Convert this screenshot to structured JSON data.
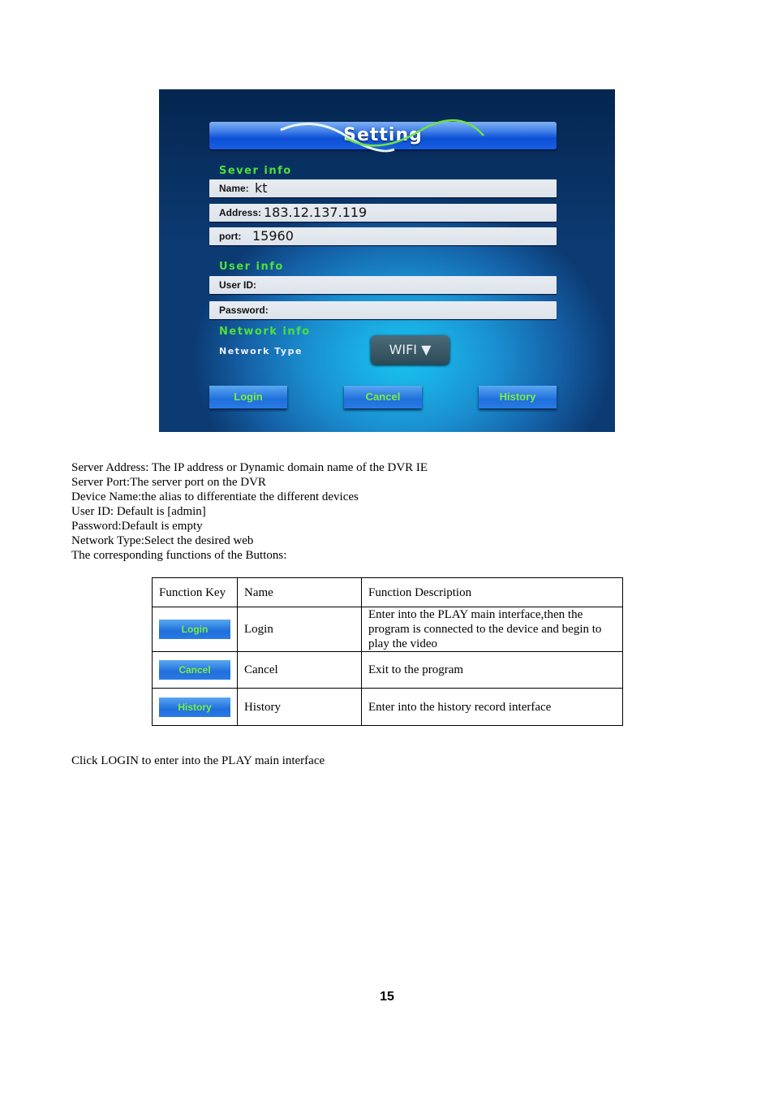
{
  "screenshot": {
    "title": "Setting",
    "server_section": "Sever info",
    "name_label": "Name:",
    "name_value": "kt",
    "address_label": "Address:",
    "address_value": "183.12.137.119",
    "port_label": "port:",
    "port_value": "15960",
    "user_section": "User info",
    "userid_label": "User ID:",
    "password_label": "Password:",
    "network_section": "Network info",
    "network_type_label": "Network Type",
    "network_type_value": "WIFI",
    "buttons": {
      "login": "Login",
      "cancel": "Cancel",
      "history": "History"
    }
  },
  "description_lines": [
    "Server Address: The IP address or Dynamic domain name of the DVR IE",
    "Server Port:The server port on the DVR",
    "Device Name:the alias to differentiate the different devices",
    "User ID: Default is [admin]",
    "Password:Default is empty",
    "Network Type:Select the desired web",
    "The corresponding functions of the Buttons:"
  ],
  "table": {
    "headers": [
      "Function Key",
      "Name",
      "Function Description"
    ],
    "rows": [
      {
        "key": "Login",
        "name": "Login",
        "desc": "Enter into the PLAY main interface,then the program is connected to the device and begin to play the video"
      },
      {
        "key": "Cancel",
        "name": "Cancel",
        "desc": "Exit to the program"
      },
      {
        "key": "History",
        "name": "History",
        "desc": "Enter into the history record interface"
      }
    ]
  },
  "footer_text": "Click LOGIN to enter into the PLAY main interface",
  "page_number": "15"
}
